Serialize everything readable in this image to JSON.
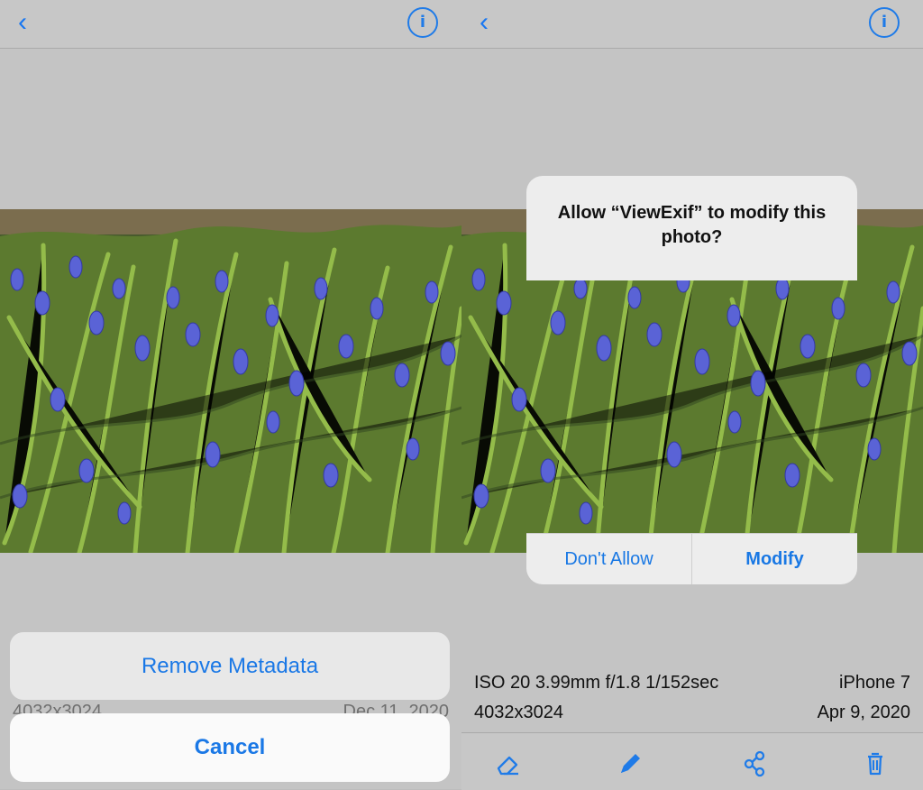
{
  "left_screen": {
    "actions": {
      "remove_metadata": "Remove Metadata",
      "cancel": "Cancel"
    },
    "meta": {
      "dimensions": "4032x3024",
      "date": "Dec 11, 2020"
    }
  },
  "right_screen": {
    "dialog": {
      "title": "Allow “ViewExif” to modify this photo?",
      "dont_allow": "Don't Allow",
      "modify": "Modify"
    },
    "meta": {
      "exposure": "ISO 20   3.99mm   f/1.8   1/152sec",
      "device": "iPhone 7",
      "dimensions": "4032x3024",
      "date": "Apr 9, 2020"
    }
  },
  "icons": {
    "back": "chevron-left-icon",
    "info": "info-icon",
    "eraser": "eraser-icon",
    "pencil": "pencil-icon",
    "share": "share-icon",
    "trash": "trash-icon"
  },
  "colors": {
    "accent": "#1f7be8",
    "dialog": "#ededed",
    "background": "#c4c4c4"
  }
}
